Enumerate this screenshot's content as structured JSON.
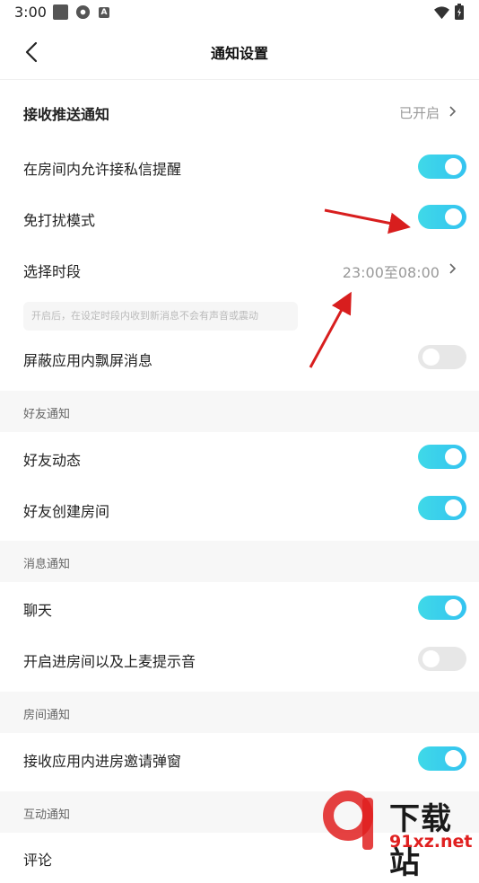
{
  "status_bar": {
    "time": "3:00",
    "icons": [
      "square-icon",
      "gear-icon",
      "a-icon",
      "wifi-icon",
      "battery-icon"
    ]
  },
  "nav": {
    "title": "通知设置",
    "back_icon": "chevron-left-icon"
  },
  "rows": {
    "receive_push": {
      "label": "接收推送通知",
      "value": "已开启"
    },
    "room_private_msg": {
      "label": "在房间内允许接私信提醒",
      "on": true
    },
    "dnd_mode": {
      "label": "免打扰模式",
      "on": true
    },
    "time_period": {
      "label": "选择时段",
      "value": "23:00至08:00"
    },
    "hint": "开启后，在设定时段内收到新消息不会有声音或震动",
    "block_float": {
      "label": "屏蔽应用内飘屏消息",
      "on": false
    }
  },
  "sections": {
    "friends": {
      "title": "好友通知",
      "items": [
        {
          "label": "好友动态",
          "on": true
        },
        {
          "label": "好友创建房间",
          "on": true
        }
      ]
    },
    "messages": {
      "title": "消息通知",
      "items": [
        {
          "label": "聊天",
          "on": true
        },
        {
          "label": "开启进房间以及上麦提示音",
          "on": false
        }
      ]
    },
    "room": {
      "title": "房间通知",
      "items": [
        {
          "label": "接收应用内进房邀请弹窗",
          "on": true
        }
      ]
    },
    "interaction": {
      "title": "互动通知",
      "items": [
        {
          "label": "评论"
        }
      ]
    }
  },
  "watermark": {
    "logo_text": "下载站",
    "url_text": "91xz.net"
  },
  "colors": {
    "toggle_on": "#3fd9e8",
    "toggle_off": "#e7e7e7",
    "section_bg": "#f7f7f7",
    "arrow": "#d81e1e"
  }
}
